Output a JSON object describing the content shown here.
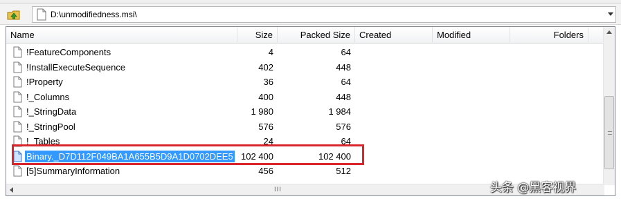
{
  "address": {
    "path": "D:\\unmodifiedness.msi\\",
    "up_icon": "folder-up-icon",
    "file_icon": "file-icon"
  },
  "columns": {
    "name": "Name",
    "size": "Size",
    "packed": "Packed Size",
    "created": "Created",
    "modified": "Modified",
    "folders": "Folders"
  },
  "rows": [
    {
      "name": "!FeatureComponents",
      "size": "4",
      "packed": "64"
    },
    {
      "name": "!InstallExecuteSequence",
      "size": "402",
      "packed": "448"
    },
    {
      "name": "!Property",
      "size": "36",
      "packed": "64"
    },
    {
      "name": "!_Columns",
      "size": "400",
      "packed": "448"
    },
    {
      "name": "!_StringData",
      "size": "1 980",
      "packed": "1 984"
    },
    {
      "name": "!_StringPool",
      "size": "576",
      "packed": "576"
    },
    {
      "name": "!_Tables",
      "size": "24",
      "packed": "64"
    },
    {
      "name": "Binary._D7D112F049BA1A655B5D9A1D0702DEE5",
      "size": "102 400",
      "packed": "102 400",
      "selected": true
    },
    {
      "name": "[5]SummaryInformation",
      "size": "456",
      "packed": "512"
    }
  ],
  "scrollbar": {
    "hgrip": "III",
    "vgrip": "≡"
  },
  "watermark": "头条 @黑客视界",
  "colors": {
    "selection": "#3399ff",
    "highlight_box": "#d9262c"
  }
}
